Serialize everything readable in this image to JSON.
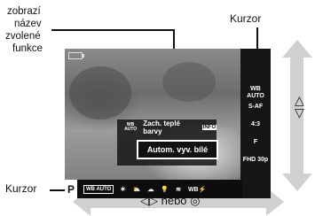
{
  "callout_left": {
    "lines": [
      "zobrazí",
      "název",
      "zvolené",
      "funkce"
    ]
  },
  "callout_cursor_top": "Kurzor",
  "callout_cursor_bottom": "Kurzor",
  "screen": {
    "info_wb_label": "WB AUTO",
    "info_text": "Zach. teplé barvy",
    "info_tag": "INFO",
    "selected_option": "Autom. vyv. bílé",
    "mode": "P",
    "sidebar": [
      "WB AUTO",
      "S-AF",
      "4:3",
      "F",
      "FHD 30p"
    ]
  },
  "bottom_strip": {
    "selected": "WB AUTO",
    "items": [
      "☀",
      "⛅",
      "☁",
      "💡",
      "≋",
      "WB⚡"
    ]
  },
  "updown_symbols": [
    "△",
    "▽"
  ],
  "lr_label": "◁▷ nebo ◎",
  "arrow_color": "#d0d0d0"
}
